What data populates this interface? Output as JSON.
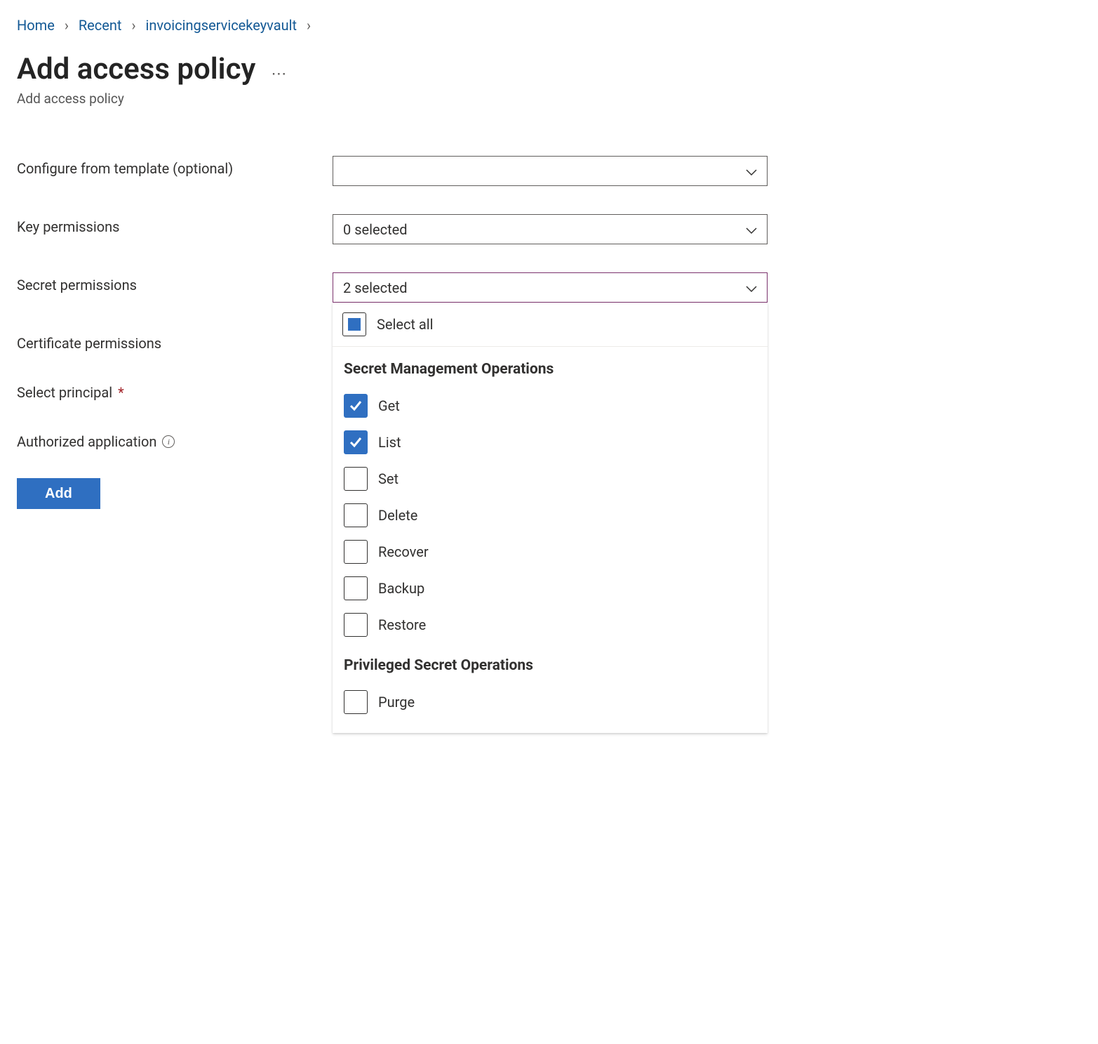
{
  "breadcrumb": {
    "items": [
      "Home",
      "Recent",
      "invoicingservicekeyvault"
    ]
  },
  "header": {
    "title": "Add access policy",
    "subtitle": "Add access policy"
  },
  "form": {
    "template": {
      "label": "Configure from template (optional)",
      "value": ""
    },
    "key_permissions": {
      "label": "Key permissions",
      "value": "0 selected"
    },
    "secret_permissions": {
      "label": "Secret permissions",
      "value": "2 selected"
    },
    "certificate_permissions": {
      "label": "Certificate permissions"
    },
    "select_principal": {
      "label": "Select principal"
    },
    "authorized_application": {
      "label": "Authorized application"
    },
    "add_button": "Add"
  },
  "secret_dropdown": {
    "select_all": "Select all",
    "groups": [
      {
        "header": "Secret Management Operations",
        "options": [
          {
            "label": "Get",
            "checked": true
          },
          {
            "label": "List",
            "checked": true
          },
          {
            "label": "Set",
            "checked": false
          },
          {
            "label": "Delete",
            "checked": false
          },
          {
            "label": "Recover",
            "checked": false
          },
          {
            "label": "Backup",
            "checked": false
          },
          {
            "label": "Restore",
            "checked": false
          }
        ]
      },
      {
        "header": "Privileged Secret Operations",
        "options": [
          {
            "label": "Purge",
            "checked": false
          }
        ]
      }
    ]
  }
}
